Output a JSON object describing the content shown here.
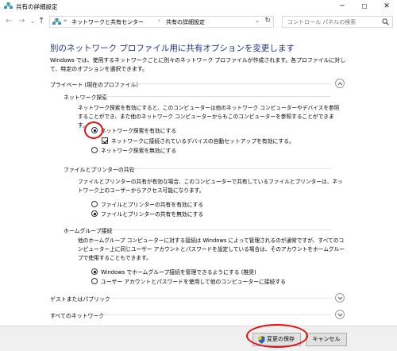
{
  "window": {
    "title": "共有の詳細設定",
    "controls": [
      "─",
      "☐",
      "✕"
    ]
  },
  "addressbar": {
    "back": "←",
    "forward": "→",
    "dropdown": "⌄",
    "up": "↑",
    "crumbs": [
      "ネットワークと共有センター",
      "共有の詳細設定"
    ],
    "refresh": "↻",
    "search_placeholder": "コントロール パネルの検索"
  },
  "main": {
    "heading": "別のネットワーク プロファイル用に共有オプションを変更します",
    "description": "Windows では、使用するネットワークごとに別々のネットワーク プロファイルが作成されます。各プロファイルに対して、特定のオプションを選択できます。"
  },
  "private_profile": {
    "title": "プライベート (現在のプロファイル)",
    "discovery": {
      "title": "ネットワーク探索",
      "text": "ネットワーク探索を有効にすると、このコンピューターは他のネットワーク コンピューターやデバイスを参照することができ、また他のネットワーク コンピューターからもこのコンピューターを参照することができます。",
      "opt_on": "ネットワーク探索を有効にする",
      "opt_auto": "ネットワークに接続されているデバイスの自動セットアップを有効にする。",
      "opt_off": "ネットワーク探索を無効にする"
    },
    "file_sharing": {
      "title": "ファイルとプリンターの共有",
      "text": "ファイルとプリンターの共有が有効な場合、このコンピューターで共有しているファイルとプリンターは、ネットワーク上のユーザーからアクセス可能になります。",
      "opt_on": "ファイルとプリンターの共有を有効にする",
      "opt_off": "ファイルとプリンターの共有を無効にする"
    },
    "homegroup": {
      "title": "ホームグループ接続",
      "text": "他のホームグループ コンピューターに対する接続は Windows によって管理されるのが通常ですが、すべてのコンピューター上に同じユーザー アカウントとパスワードを設定している場合は、そのアカウントをホームグループで使用することもできます。",
      "opt_windows": "Windows でホームグループ接続を管理できるようにする (推奨)",
      "opt_account": "ユーザー アカウントとパスワードを使用して他のコンピューターに接続する"
    }
  },
  "guest_profile": {
    "title": "ゲストまたはパブリック"
  },
  "all_profile": {
    "title": "すべてのネットワーク"
  },
  "footer": {
    "save_label": "変更の保存",
    "cancel_label": "キャンセル"
  },
  "colors": {
    "heading": "#1e3287",
    "highlight_ring": "#e01010"
  }
}
